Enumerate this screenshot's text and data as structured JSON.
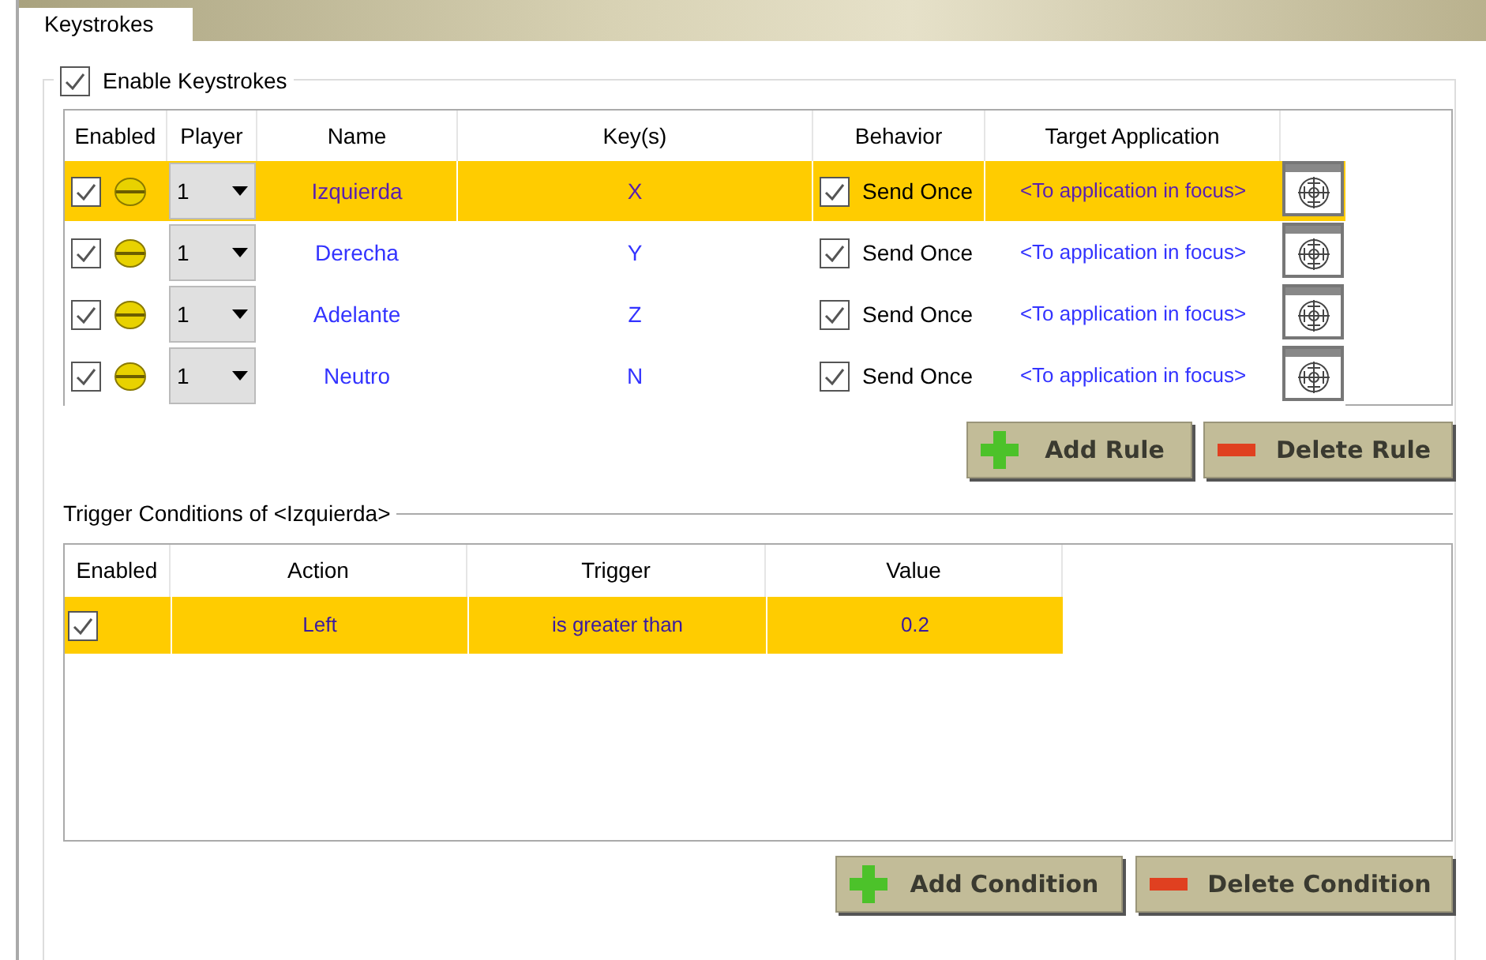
{
  "tabs": [
    {
      "label": "Keystrokes",
      "selected": true
    }
  ],
  "enable_keystrokes": {
    "label": "Enable Keystrokes",
    "checked": true
  },
  "rules_table": {
    "columns": [
      "Enabled",
      "Player",
      "Name",
      "Key(s)",
      "Behavior",
      "Target Application"
    ],
    "rows": [
      {
        "enabled": true,
        "player": "1",
        "name": "Izquierda",
        "keys": "X",
        "behavior_checked": true,
        "behavior": "Send Once",
        "target": "<To application in focus>",
        "selected": true
      },
      {
        "enabled": true,
        "player": "1",
        "name": "Derecha",
        "keys": "Y",
        "behavior_checked": true,
        "behavior": "Send Once",
        "target": "<To application in focus>",
        "selected": false
      },
      {
        "enabled": true,
        "player": "1",
        "name": "Adelante",
        "keys": "Z",
        "behavior_checked": true,
        "behavior": "Send Once",
        "target": "<To application in focus>",
        "selected": false
      },
      {
        "enabled": true,
        "player": "1",
        "name": "Neutro",
        "keys": "N",
        "behavior_checked": true,
        "behavior": "Send Once",
        "target": "<To application in focus>",
        "selected": false
      }
    ]
  },
  "rule_buttons": [
    {
      "kind": "add",
      "label": "Add Rule"
    },
    {
      "kind": "delete",
      "label": "Delete Rule"
    }
  ],
  "trigger_conditions": {
    "title": "Trigger Conditions of <Izquierda>",
    "columns": [
      "Enabled",
      "Action",
      "Trigger",
      "Value"
    ],
    "rows": [
      {
        "enabled": true,
        "action": "Left",
        "trigger": "is greater than",
        "value": "0.2",
        "selected": true
      }
    ]
  },
  "condition_buttons": [
    {
      "kind": "add",
      "label": "Add Condition"
    },
    {
      "kind": "delete",
      "label": "Delete Condition"
    }
  ]
}
